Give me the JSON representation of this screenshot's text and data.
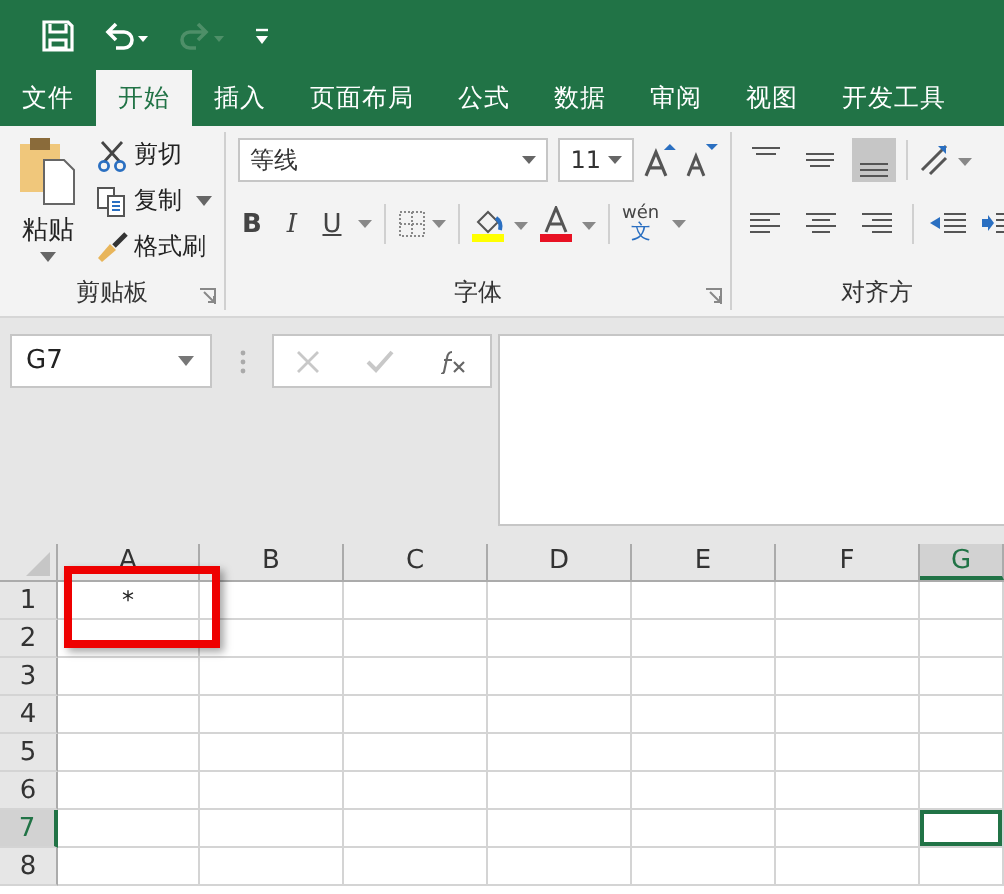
{
  "tabs": [
    {
      "label": "文件",
      "selected": false
    },
    {
      "label": "开始",
      "selected": true
    },
    {
      "label": "插入",
      "selected": false
    },
    {
      "label": "页面布局",
      "selected": false
    },
    {
      "label": "公式",
      "selected": false
    },
    {
      "label": "数据",
      "selected": false
    },
    {
      "label": "审阅",
      "selected": false
    },
    {
      "label": "视图",
      "selected": false
    },
    {
      "label": "开发工具",
      "selected": false
    }
  ],
  "clipboard": {
    "paste": "粘贴",
    "cut": "剪切",
    "copy": "复制",
    "format_painter": "格式刷",
    "label": "剪贴板"
  },
  "font": {
    "styles": [
      {
        "label": "B",
        "kind": "bold"
      },
      {
        "label": "I",
        "kind": "italic"
      },
      {
        "label": "U",
        "kind": "underline"
      }
    ],
    "name": "等线",
    "size": "11",
    "phonetic": "wén",
    "phonetic_char": "文",
    "label": "字体"
  },
  "alignment": {
    "label": "对齐方",
    "bottom_align_selected": true
  },
  "formula_bar": {
    "name_box": "G7"
  },
  "sheet": {
    "columns": [
      {
        "label": "A",
        "selected": false
      },
      {
        "label": "B",
        "selected": false
      },
      {
        "label": "C",
        "selected": false
      },
      {
        "label": "D",
        "selected": false
      },
      {
        "label": "E",
        "selected": false
      },
      {
        "label": "F",
        "selected": false
      },
      {
        "label": "G",
        "selected": true
      }
    ],
    "rows": [
      {
        "label": "1",
        "selected": false,
        "cells": [
          "*"
        ]
      },
      {
        "label": "2",
        "selected": false,
        "cells": []
      },
      {
        "label": "3",
        "selected": false,
        "cells": []
      },
      {
        "label": "4",
        "selected": false,
        "cells": []
      },
      {
        "label": "5",
        "selected": false,
        "cells": []
      },
      {
        "label": "6",
        "selected": false,
        "cells": []
      },
      {
        "label": "7",
        "selected": true,
        "cells": []
      },
      {
        "label": "8",
        "selected": false,
        "cells": []
      }
    ]
  }
}
